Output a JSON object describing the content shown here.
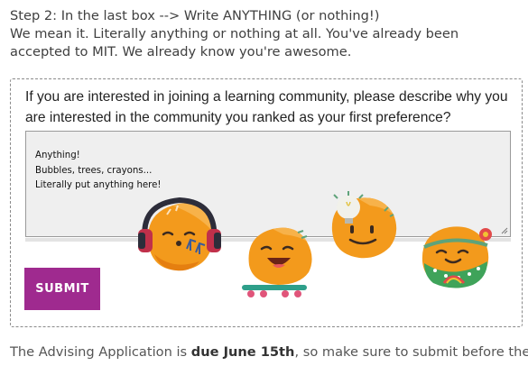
{
  "intro": {
    "line1": "Step 2: In the last box --> Write ANYTHING (or nothing!)",
    "line2": "We mean it. Literally anything or nothing at all. You've already been accepted to MIT. We already know you're awesome."
  },
  "form": {
    "question": "If you are interested in joining a learning community, please describe why you are interested in the community you ranked as your first preference?",
    "answer_lines": [
      "Anything!",
      "Bubbles, trees, crayons...",
      "Literally put anything here!"
    ],
    "submit_label": "SUBMIT"
  },
  "deadline": {
    "prefix": "The Advising Application is ",
    "date": "due June 15th",
    "suffix": ", so make sure to submit before then!"
  },
  "colors": {
    "submit": "#9f2a8f",
    "blob_orange": "#f39a1c",
    "blob_shade": "#e57f10"
  },
  "emojis": [
    "headphones-blob",
    "skateboard-blob",
    "lightbulb-blob",
    "flower-crown-blob"
  ]
}
